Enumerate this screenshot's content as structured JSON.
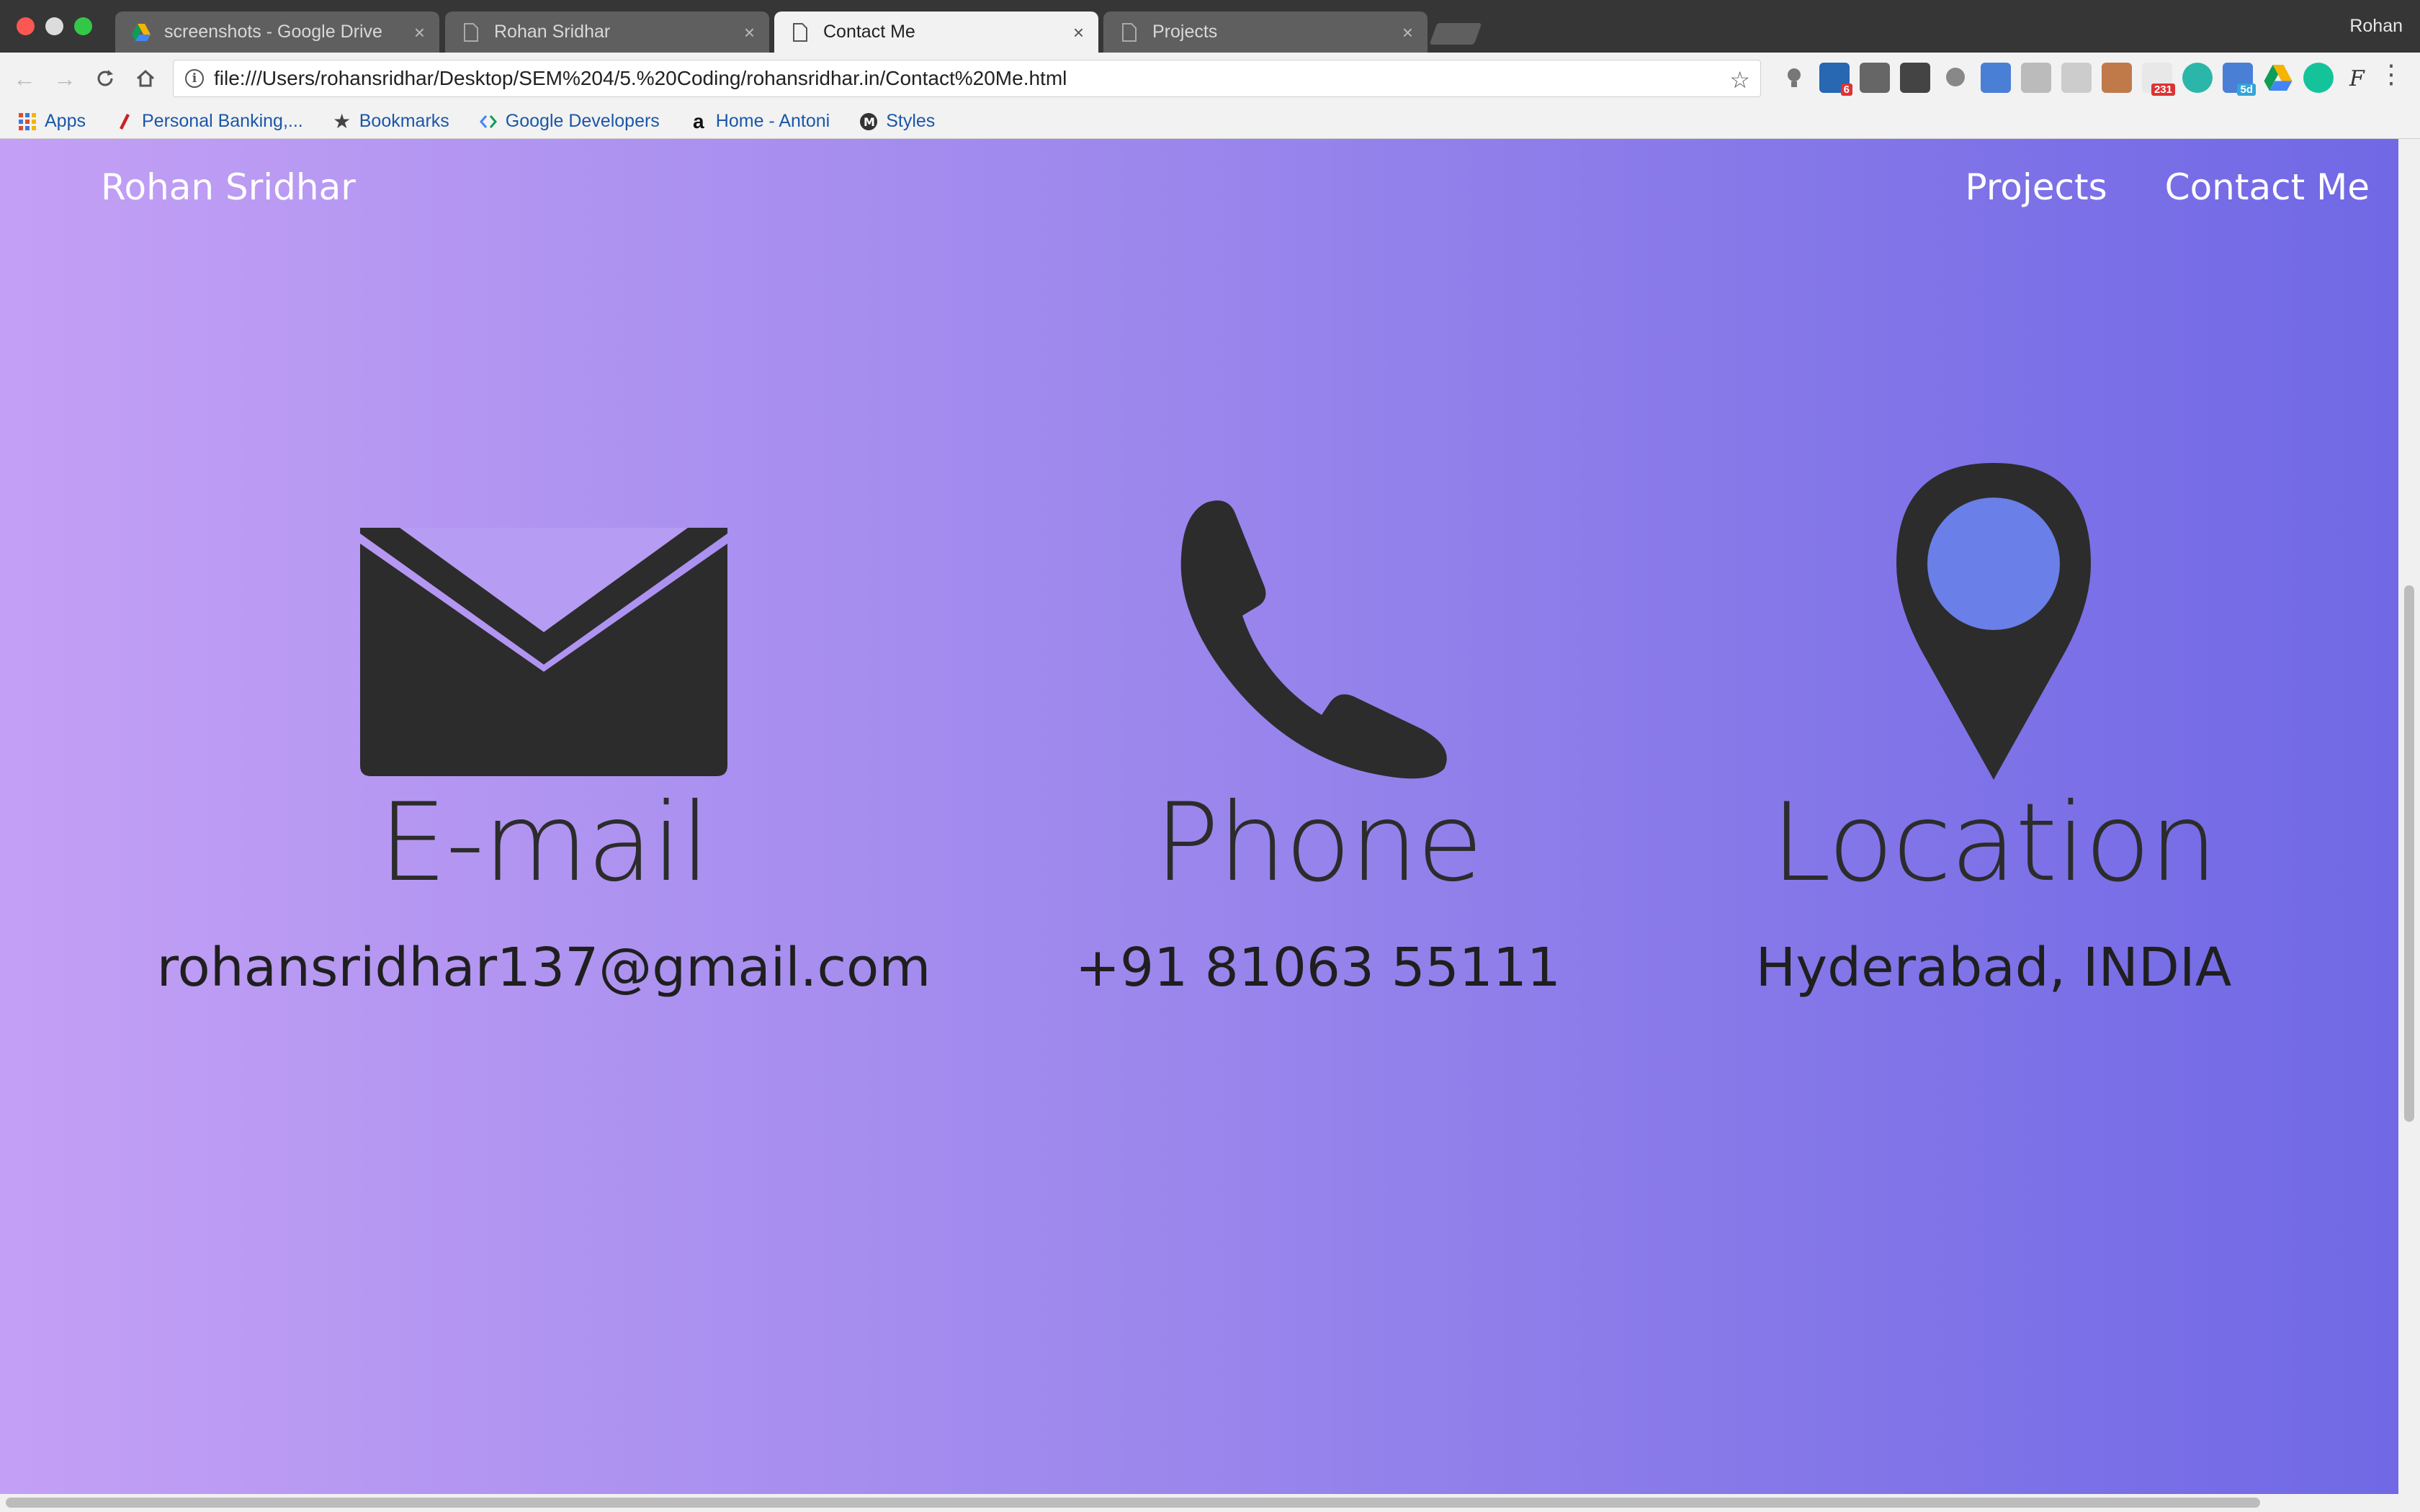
{
  "browser": {
    "tabs": [
      {
        "label": "screenshots - Google Drive",
        "icon": "google-drive-icon"
      },
      {
        "label": "Rohan Sridhar",
        "icon": "document-icon"
      },
      {
        "label": "Contact Me",
        "icon": "document-icon",
        "active": true
      },
      {
        "label": "Projects",
        "icon": "document-icon"
      }
    ],
    "profile": "Rohan",
    "url": "file:///Users/rohansridhar/Desktop/SEM%204/5.%20Coding/rohansridhar.in/Contact%20Me.html",
    "extension_badges": {
      "linkedin": "6",
      "counter": "231",
      "calendar": "5d"
    },
    "bookmarks": [
      {
        "label": "Apps",
        "icon": "apps-grid-icon"
      },
      {
        "label": "Personal Banking,...",
        "icon": "bank-icon"
      },
      {
        "label": "Bookmarks",
        "icon": "star-icon"
      },
      {
        "label": "Google Developers",
        "icon": "google-developers-icon"
      },
      {
        "label": "Home - Antoni",
        "icon": "amazon-icon"
      },
      {
        "label": "Styles",
        "icon": "styles-icon"
      }
    ]
  },
  "site": {
    "brand": "Rohan Sridhar",
    "nav": {
      "projects": "Projects",
      "contact": "Contact Me"
    },
    "contacts": [
      {
        "title": "E-mail",
        "value": "rohansridhar137@gmail.com",
        "icon": "envelope-icon"
      },
      {
        "title": "Phone",
        "value": "+91 81063 55111",
        "icon": "phone-icon"
      },
      {
        "title": "Location",
        "value": "Hyderabad, INDIA",
        "icon": "location-pin-icon"
      }
    ],
    "colors": {
      "gradient_start": "#c3a0f5",
      "gradient_end": "#7068e5",
      "icon": "#2c2c2c",
      "pin_dot": "#6a7fe8"
    }
  }
}
